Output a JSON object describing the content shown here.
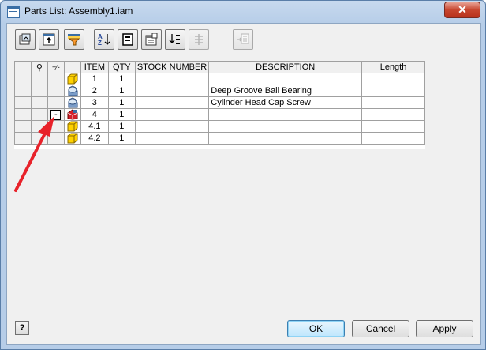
{
  "window": {
    "title": "Parts List: Assembly1.iam",
    "close_label": "✕"
  },
  "toolbar": {
    "buttons": [
      {
        "name": "filter-icon",
        "enabled": true
      },
      {
        "name": "export-icon",
        "enabled": true
      },
      {
        "name": "funnel-icon",
        "enabled": true
      },
      {
        "name": "sort-az-icon",
        "enabled": true
      },
      {
        "name": "renumber-icon",
        "enabled": true
      },
      {
        "name": "column-chooser-icon",
        "enabled": true
      },
      {
        "name": "group-icon",
        "enabled": true
      },
      {
        "name": "merge-icon",
        "enabled": false
      },
      {
        "name": "member-icon",
        "enabled": false
      }
    ]
  },
  "grid": {
    "headers": {
      "search": "⚲",
      "expand": "+⁄-",
      "icon": "",
      "item": "ITEM",
      "qty": "QTY",
      "stock_number": "STOCK NUMBER",
      "description": "DESCRIPTION",
      "length": "Length"
    },
    "rows": [
      {
        "item": "1",
        "qty": "1",
        "stock": "",
        "description": "",
        "length": "",
        "icon": "part",
        "expander": ""
      },
      {
        "item": "2",
        "qty": "1",
        "stock": "",
        "description": "Deep Groove Ball Bearing",
        "length": "",
        "icon": "cc-part",
        "expander": ""
      },
      {
        "item": "3",
        "qty": "1",
        "stock": "",
        "description": "Cylinder Head Cap Screw",
        "length": "",
        "icon": "cc-part",
        "expander": ""
      },
      {
        "item": "4",
        "qty": "1",
        "stock": "",
        "description": "",
        "length": "",
        "icon": "assembly",
        "expander": "-"
      },
      {
        "item": "4.1",
        "qty": "1",
        "stock": "",
        "description": "",
        "length": "",
        "icon": "part",
        "expander": ""
      },
      {
        "item": "4.2",
        "qty": "1",
        "stock": "",
        "description": "",
        "length": "",
        "icon": "part",
        "expander": ""
      }
    ]
  },
  "footer": {
    "help_label": "?",
    "ok_label": "OK",
    "cancel_label": "Cancel",
    "apply_label": "Apply"
  },
  "colors": {
    "annotation_arrow": "#e8222a",
    "part_icon": "#f5c400",
    "assembly_icon": "#d4202a",
    "cc_icon": "#3a6ea5"
  }
}
